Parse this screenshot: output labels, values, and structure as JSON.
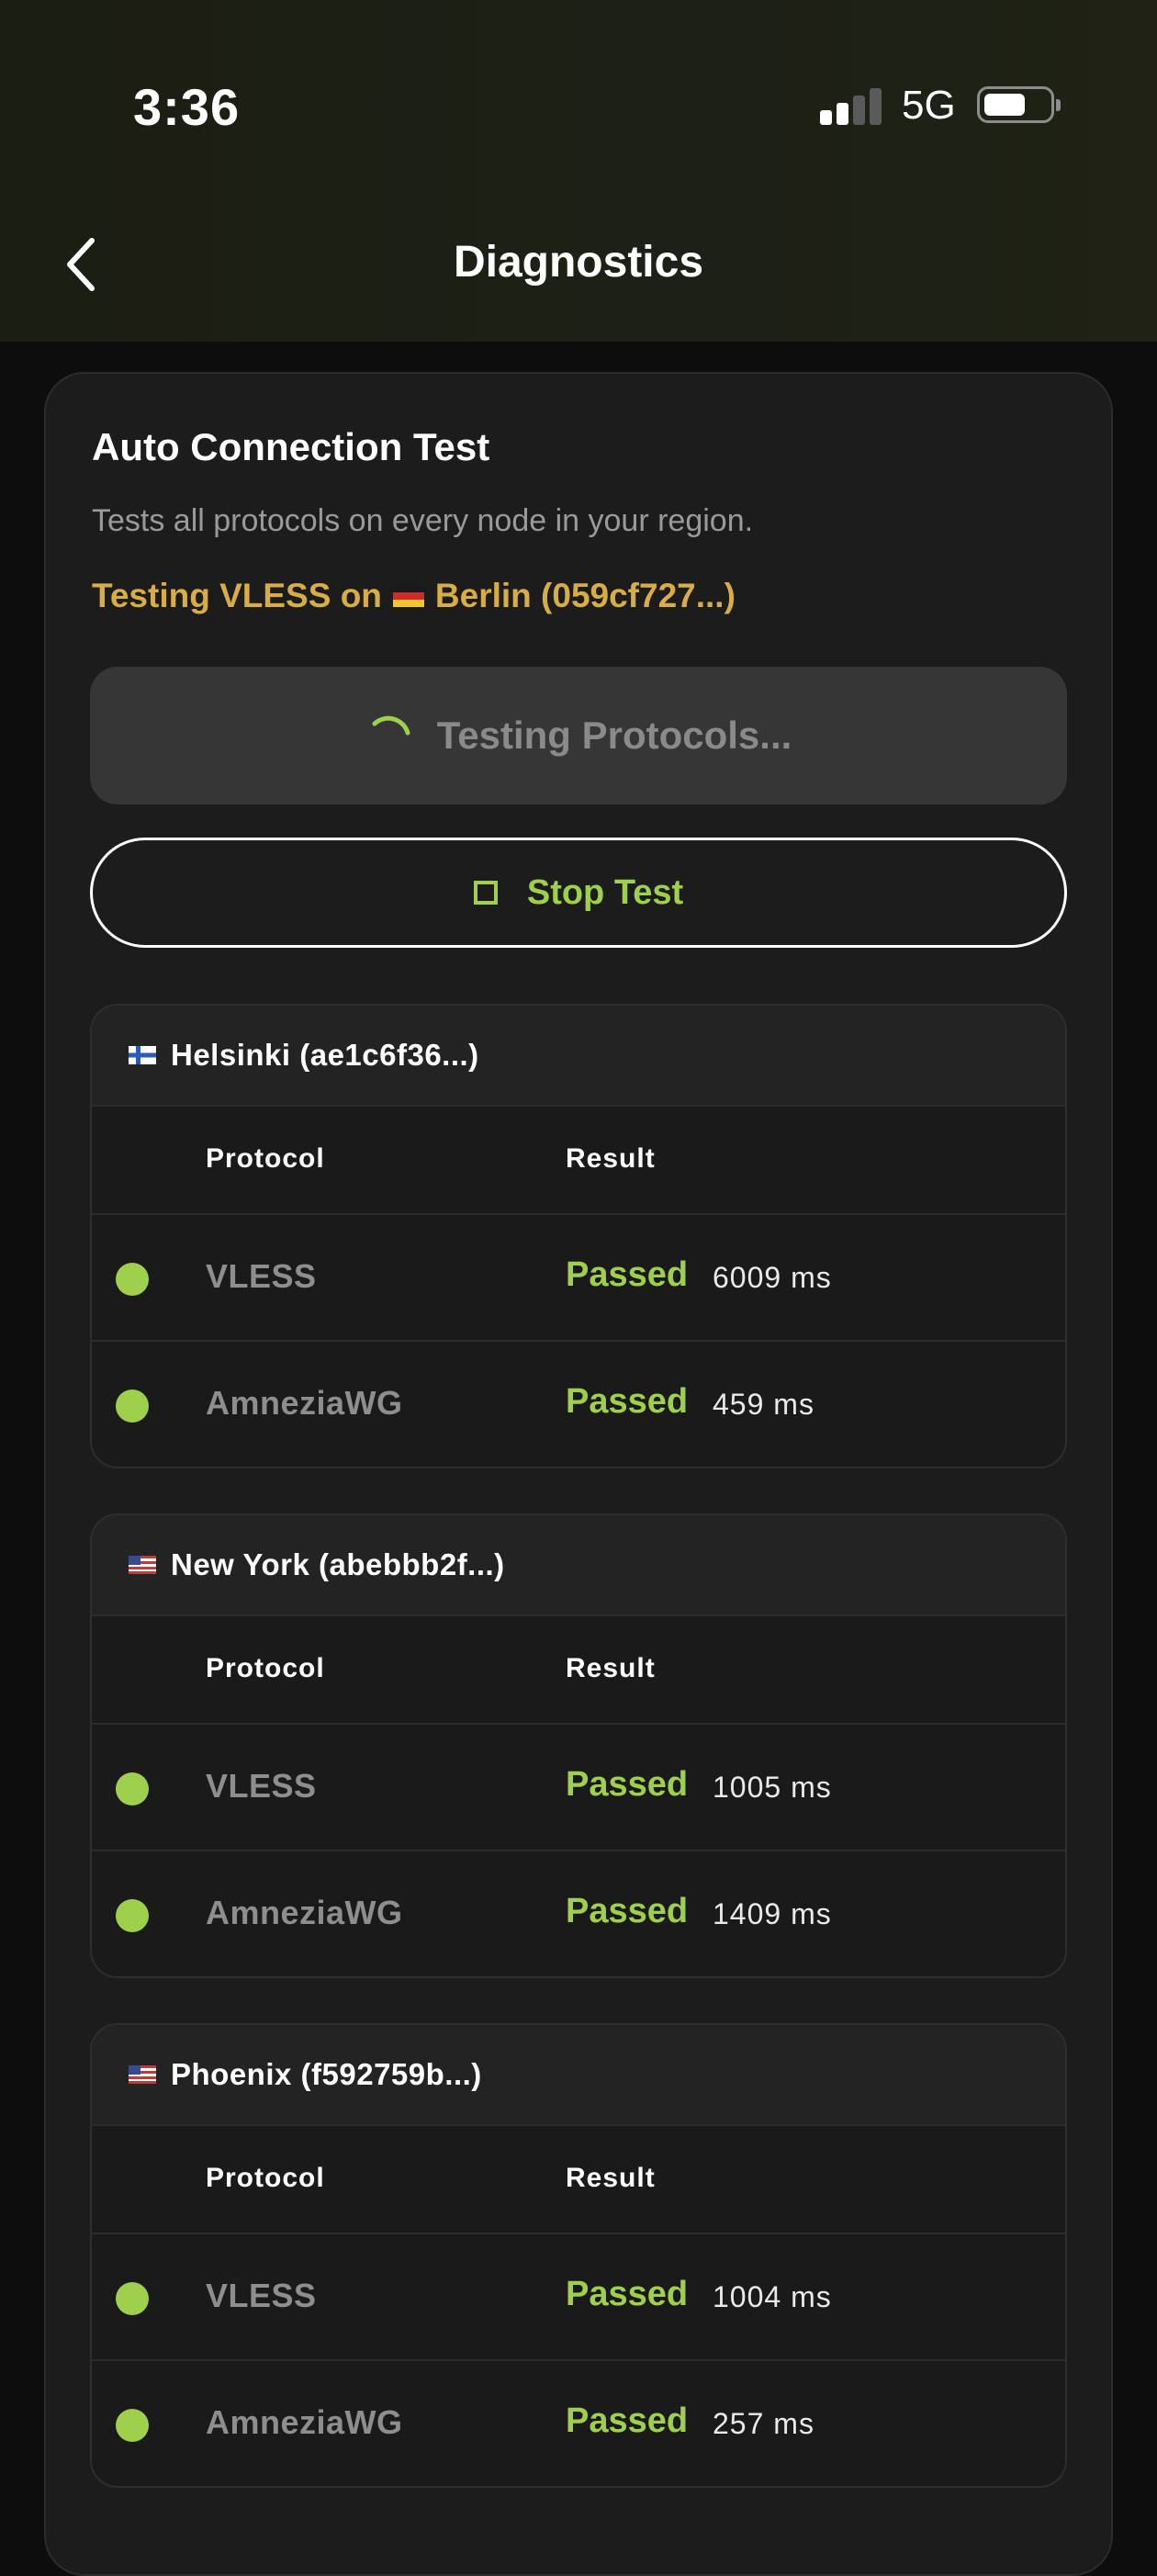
{
  "status_bar": {
    "time": "3:36",
    "network": "5G"
  },
  "nav": {
    "title": "Diagnostics"
  },
  "card": {
    "title": "Auto Connection Test",
    "subtitle": "Tests all protocols on every node in your region.",
    "testing_prefix": "Testing VLESS on",
    "testing_node": "Berlin (059cf727...)",
    "testing_button": "Testing Protocols...",
    "stop_button": "Stop Test"
  },
  "table_headers": {
    "protocol": "Protocol",
    "result": "Result"
  },
  "nodes": [
    {
      "name": "Helsinki (ae1c6f36...)",
      "rows": [
        {
          "protocol": "VLESS",
          "status": "Passed",
          "latency": "6009 ms"
        },
        {
          "protocol": "AmneziaWG",
          "status": "Passed",
          "latency": "459 ms"
        }
      ]
    },
    {
      "name": "New York (abebbb2f...)",
      "rows": [
        {
          "protocol": "VLESS",
          "status": "Passed",
          "latency": "1005 ms"
        },
        {
          "protocol": "AmneziaWG",
          "status": "Passed",
          "latency": "1409 ms"
        }
      ]
    },
    {
      "name": "Phoenix (f592759b...)",
      "rows": [
        {
          "protocol": "VLESS",
          "status": "Passed",
          "latency": "1004 ms"
        },
        {
          "protocol": "AmneziaWG",
          "status": "Passed",
          "latency": "257 ms"
        }
      ]
    }
  ],
  "colors": {
    "accent_green": "#9fd04b",
    "status_gold": "#d9ad45",
    "card_bg": "#1c1c1c"
  },
  "icons": {
    "back": "chevron-left-icon",
    "spinner": "spinner-icon",
    "stop": "stop-square-icon",
    "flags": [
      "finland-flag-icon",
      "usa-flag-icon",
      "usa-flag-icon",
      "germany-flag-icon"
    ]
  }
}
